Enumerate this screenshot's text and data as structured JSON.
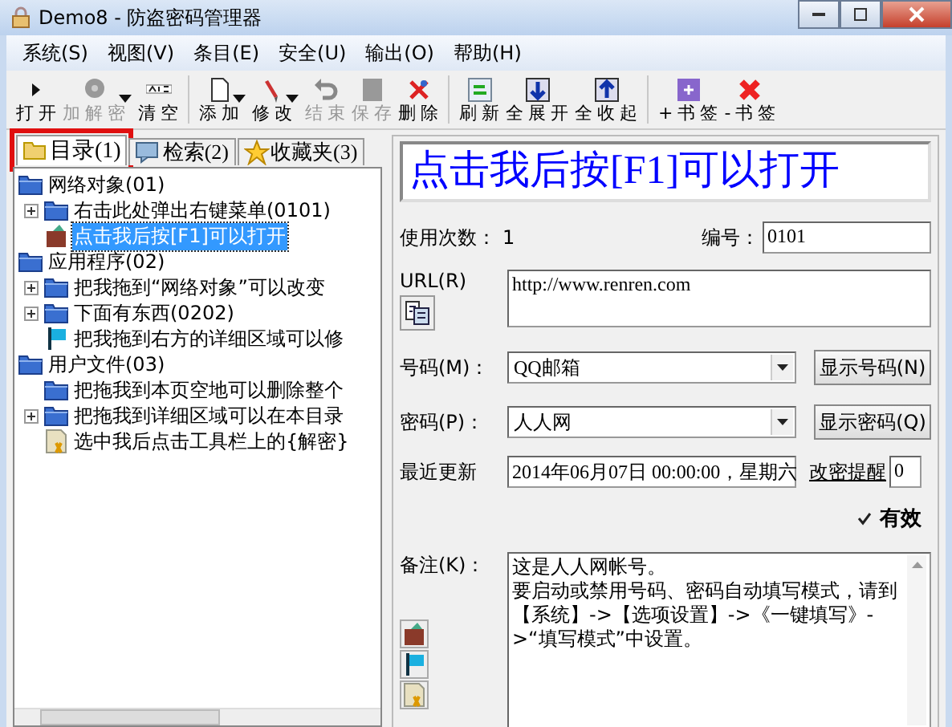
{
  "window": {
    "title": "Demo8 - 防盗密码管理器"
  },
  "menu": [
    {
      "label": "系统(S)"
    },
    {
      "label": "视图(V)"
    },
    {
      "label": "条目(E)"
    },
    {
      "label": "安全(U)"
    },
    {
      "label": "输出(O)"
    },
    {
      "label": "帮助(H)"
    }
  ],
  "toolbar": [
    [
      {
        "label": "打开",
        "disabled": false,
        "dropdown": false
      },
      {
        "label": "加解密",
        "disabled": true,
        "dropdown": true
      },
      {
        "label": "清空",
        "disabled": false,
        "dropdown": false
      }
    ],
    [
      {
        "label": "添加",
        "disabled": false,
        "dropdown": true
      },
      {
        "label": "修改",
        "disabled": false,
        "dropdown": true
      },
      {
        "label": "结束",
        "disabled": true,
        "dropdown": false
      },
      {
        "label": "保存",
        "disabled": true,
        "dropdown": false
      },
      {
        "label": "删除",
        "disabled": false,
        "dropdown": false
      }
    ],
    [
      {
        "label": "刷新",
        "disabled": false,
        "dropdown": false
      },
      {
        "label": "全展开",
        "disabled": false,
        "dropdown": false
      },
      {
        "label": "全收起",
        "disabled": false,
        "dropdown": false
      }
    ],
    [
      {
        "label": "+书签",
        "disabled": false,
        "dropdown": false
      },
      {
        "label": "-书签",
        "disabled": false,
        "dropdown": false
      }
    ]
  ],
  "tabs": [
    {
      "label": "目录(1)",
      "selected": true,
      "highlighted": true
    },
    {
      "label": "检索(2)",
      "selected": false,
      "highlighted": false
    },
    {
      "label": "收藏夹(3)",
      "selected": false,
      "highlighted": false
    }
  ],
  "tree": [
    {
      "label": "网络对象(01)",
      "kind": "folder",
      "selected": false,
      "children": [
        {
          "label": "右击此处弹出右键菜单(0101)",
          "kind": "folder",
          "expandable": true,
          "selected": false
        },
        {
          "label": "点击我后按[F1]可以打开",
          "kind": "wallet",
          "expandable": false,
          "selected": true
        }
      ]
    },
    {
      "label": "应用程序(02)",
      "kind": "folder",
      "selected": false,
      "children": [
        {
          "label": "把我拖到“网络对象”可以改变",
          "kind": "folder",
          "expandable": true,
          "selected": false
        },
        {
          "label": "下面有东西(0202)",
          "kind": "folder",
          "expandable": true,
          "selected": false
        },
        {
          "label": "把我拖到右方的详细区域可以修",
          "kind": "flag",
          "expandable": false,
          "selected": false
        }
      ]
    },
    {
      "label": "用户文件(03)",
      "kind": "folder",
      "selected": false,
      "children": [
        {
          "label": "把拖我到本页空地可以删除整个",
          "kind": "folder",
          "expandable": false,
          "selected": false
        },
        {
          "label": "把拖我到详细区域可以在本目录",
          "kind": "folder",
          "expandable": true,
          "selected": false
        },
        {
          "label": "选中我后点击工具栏上的{解密}",
          "kind": "document",
          "expandable": false,
          "selected": false
        }
      ]
    }
  ],
  "detail": {
    "title": "点击我后按[F1]可以打开",
    "usage_label": "使用次数：",
    "usage_value": "1",
    "number_label": "编号：",
    "number_value": "0101",
    "url_label": "URL(R)",
    "url_value": "http://www.renren.com",
    "account_label": "号码(M)：",
    "account_value": "QQ邮箱",
    "show_account_button": "显示号码(N)",
    "password_label": "密码(P)：",
    "password_value": "人人网",
    "show_password_button": "显示密码(Q)",
    "updated_label": "最近更新",
    "updated_value": "2014年06月07日 00:00:00，星期六",
    "reminder_link": "改密提醒",
    "reminder_value": "0",
    "valid": {
      "label": "有效",
      "checked": true
    },
    "notes_label": "备注(K)：",
    "notes_lines": [
      "这是人人网帐号。",
      "要启动或禁用号码、密码自动填写模式，请到【系统】->【选项设置】->《一键填写》->“填写模式”中设置。"
    ]
  }
}
